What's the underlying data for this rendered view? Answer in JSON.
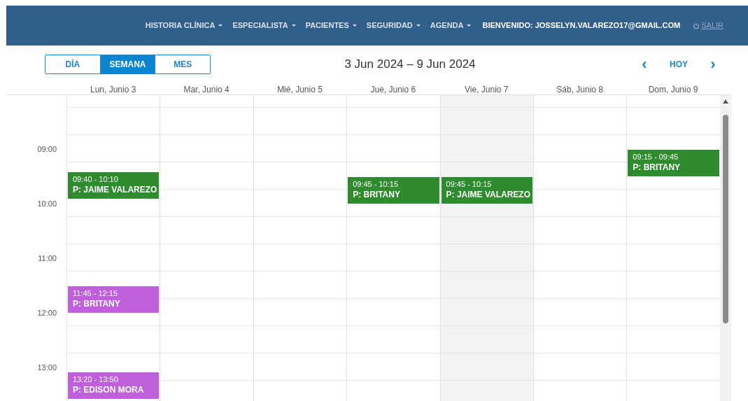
{
  "nav": {
    "menus": [
      {
        "label": "HISTORIA CLÍNICA"
      },
      {
        "label": "ESPECIALISTA"
      },
      {
        "label": "PACIENTES"
      },
      {
        "label": "SEGURIDAD"
      },
      {
        "label": "AGENDA"
      }
    ],
    "welcome": "BIENVENIDO: JOSSELYN.VALAREZO17@GMAIL.COM",
    "logout": "SALIR"
  },
  "toolbar": {
    "views": [
      {
        "label": "DÍA",
        "selected": false
      },
      {
        "label": "SEMANA",
        "selected": true
      },
      {
        "label": "MES",
        "selected": false
      }
    ],
    "range": "3 Jun 2024 – 9 Jun 2024",
    "prev": "‹",
    "today": "HOY",
    "next": "›"
  },
  "time_labels": [
    "09:00",
    "10:00",
    "11:00",
    "12:00",
    "13:00"
  ],
  "days": [
    {
      "label": "Lun, Junio 3",
      "today": false,
      "events": [
        {
          "time": "09:40 - 10:10",
          "title": "P: JAIME VALAREZO",
          "color": "#2e8b2e"
        },
        {
          "time": "11:45 - 12:15",
          "title": "P: BRITANY",
          "color": "#bf5fdc"
        },
        {
          "time": "13:20 - 13:50",
          "title": "P: EDISON MORA",
          "color": "#bf5fdc"
        }
      ]
    },
    {
      "label": "Mar, Junio 4",
      "today": false
    },
    {
      "label": "Mié, Junio 5",
      "today": false
    },
    {
      "label": "Jue, Junio 6",
      "today": false,
      "events": [
        {
          "time": "09:45 - 10:15",
          "title": "P: BRITANY",
          "color": "#2e8b2e"
        }
      ]
    },
    {
      "label": "Vie, Junio 7",
      "today": true,
      "events": [
        {
          "time": "09:45 - 10:15",
          "title": "P: JAIME VALAREZO",
          "color": "#2e8b2e"
        }
      ]
    },
    {
      "label": "Sáb, Junio 8",
      "today": false
    },
    {
      "label": "Dom, Junio 9",
      "today": false,
      "events": [
        {
          "time": "09:15 - 09:45",
          "title": "P: BRITANY",
          "color": "#2e8b2e"
        }
      ]
    }
  ]
}
